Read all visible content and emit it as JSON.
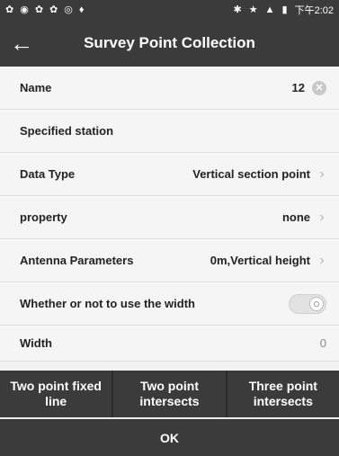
{
  "status_bar": {
    "time": "下午2:02",
    "left_icons": [
      "settings-icon",
      "wifi-icon",
      "sync-icon",
      "sync-icon",
      "location-icon",
      "pin-icon"
    ],
    "right_icons": [
      "bluetooth-icon",
      "star-icon",
      "signal-icon",
      "battery-icon"
    ]
  },
  "header": {
    "title": "Survey Point Collection",
    "back_icon": "arrow-left-icon"
  },
  "fields": {
    "name": {
      "label": "Name",
      "value": "12"
    },
    "specified_station": {
      "label": "Specified station"
    },
    "data_type": {
      "label": "Data Type",
      "value": "Vertical section point"
    },
    "property": {
      "label": "property",
      "value": "none"
    },
    "antenna": {
      "label": "Antenna Parameters",
      "value": "0m,Vertical height"
    },
    "use_width": {
      "label": "Whether or not to use the width",
      "enabled": false
    },
    "width": {
      "label": "Width",
      "value": "0"
    }
  },
  "actions": {
    "two_point_fixed": "Two point fixed line",
    "two_point_intersects": "Two point intersects",
    "three_point_intersects": "Three point intersects"
  },
  "ok_label": "OK",
  "colors": {
    "bar": "#3b3b3b",
    "list_bg": "#f5f5f5"
  }
}
